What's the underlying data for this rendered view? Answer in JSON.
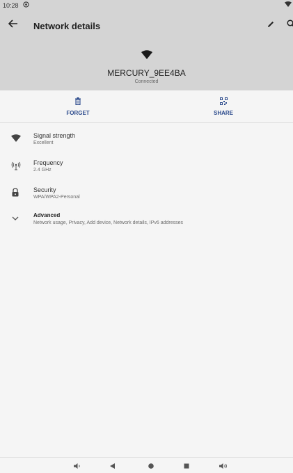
{
  "status_bar": {
    "time": "10:28"
  },
  "app_bar": {
    "title": "Network details"
  },
  "network": {
    "ssid": "MERCURY_9EE4BA",
    "status": "Connected"
  },
  "actions": [
    {
      "label": "FORGET",
      "icon": "trash-icon"
    },
    {
      "label": "SHARE",
      "icon": "qr-code-icon"
    }
  ],
  "details": [
    {
      "icon": "wifi-signal-icon",
      "title": "Signal strength",
      "value": "Excellent"
    },
    {
      "icon": "antenna-icon",
      "title": "Frequency",
      "value": "2.4 GHz"
    },
    {
      "icon": "lock-icon",
      "title": "Security",
      "value": "WPA/WPA2-Personal"
    },
    {
      "icon": "chevron-down-icon",
      "title": "Advanced",
      "value": "Network usage, Privacy, Add device, Network details, IPv6 addresses"
    }
  ],
  "colors": {
    "bar": "#d4d4d4",
    "accent": "#2b4a8c",
    "background": "#f5f5f5"
  }
}
